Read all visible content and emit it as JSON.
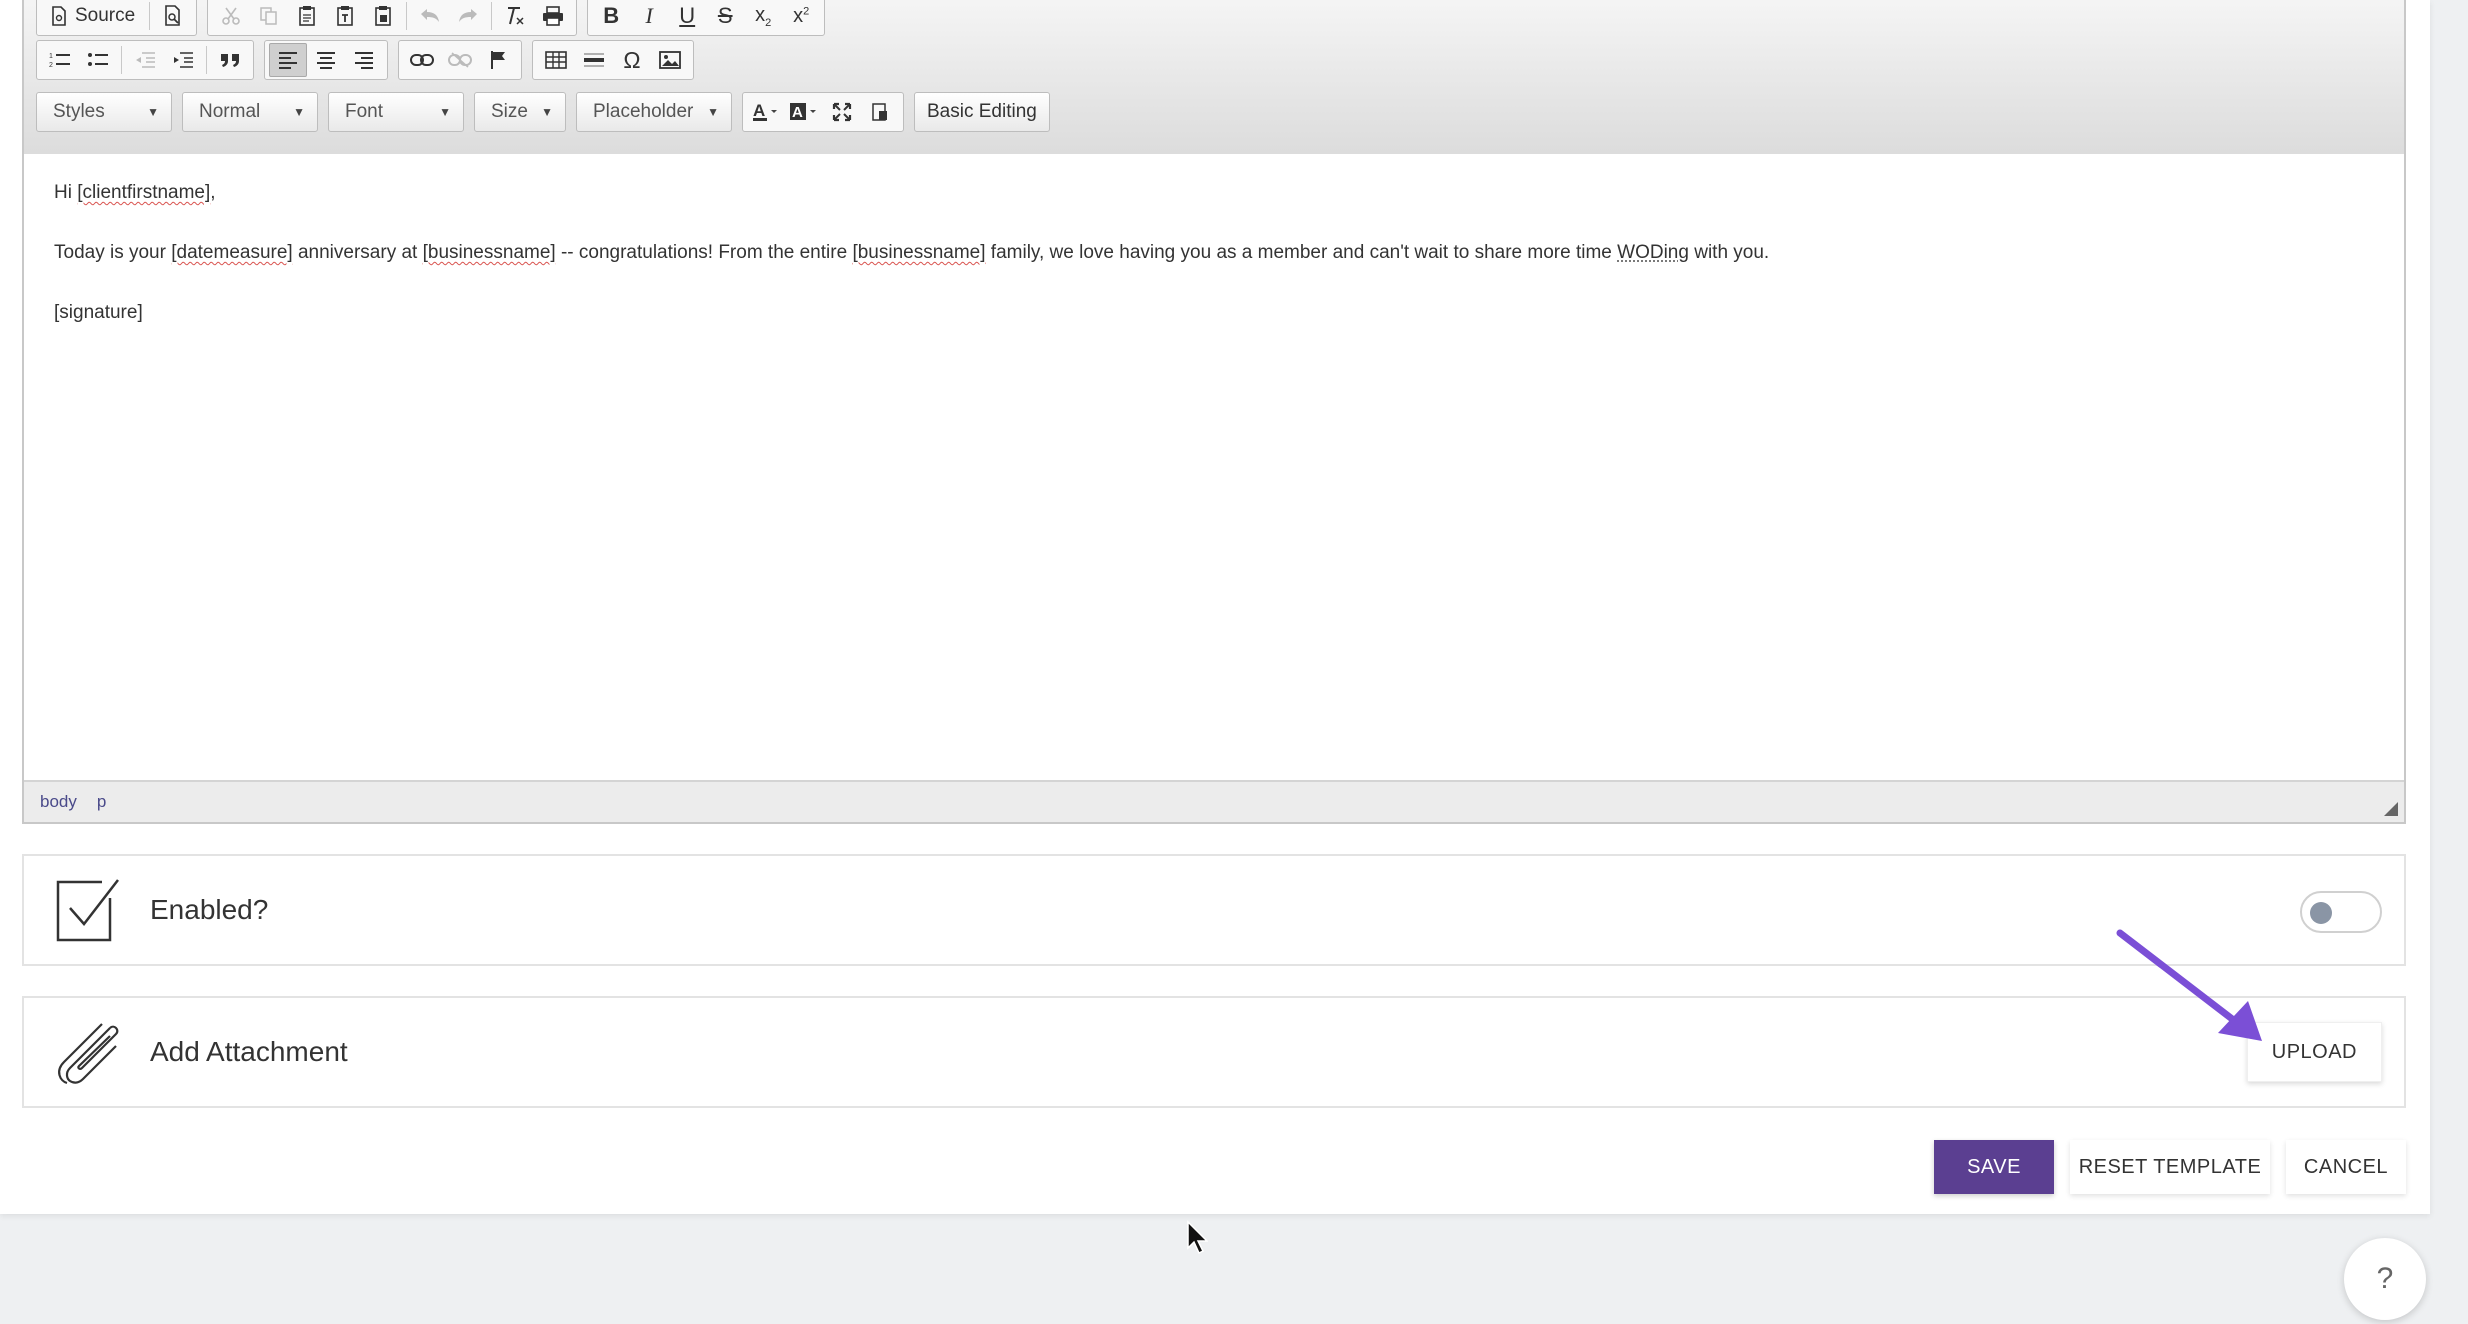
{
  "toolbar": {
    "source_label": "Source",
    "styles_label": "Styles",
    "format_label": "Normal",
    "font_label": "Font",
    "size_label": "Size",
    "placeholder_label": "Placeholder",
    "basic_editing_label": "Basic Editing",
    "omega_glyph": "Ω"
  },
  "content": {
    "greeting_prefix": "Hi ",
    "greeting_tag": "[clientfirstname]",
    "greeting_suffix": ",",
    "body_1": "Today is your ",
    "tag_datemeasure": "[datemeasure]",
    "body_2": " anniversary at ",
    "tag_businessname": "[businessname]",
    "body_3": " -- congratulations! From the entire ",
    "tag_businessname_2": "[businessname]",
    "body_4": " family, we love having you as a member and can't wait to share more time ",
    "word_woding": "WODing",
    "body_5": " with you.",
    "signature": "[signature]"
  },
  "status_bar": {
    "path": [
      "body",
      "p"
    ]
  },
  "settings": {
    "enabled_label": "Enabled?",
    "enabled_value": false,
    "attachment_label": "Add Attachment",
    "upload_label": "UPLOAD"
  },
  "actions": {
    "save_label": "SAVE",
    "reset_label": "RESET TEMPLATE",
    "cancel_label": "CANCEL"
  },
  "help": {
    "label": "?"
  },
  "colors": {
    "primary": "#5b3f91",
    "annotation_arrow": "#7b4fd6"
  }
}
